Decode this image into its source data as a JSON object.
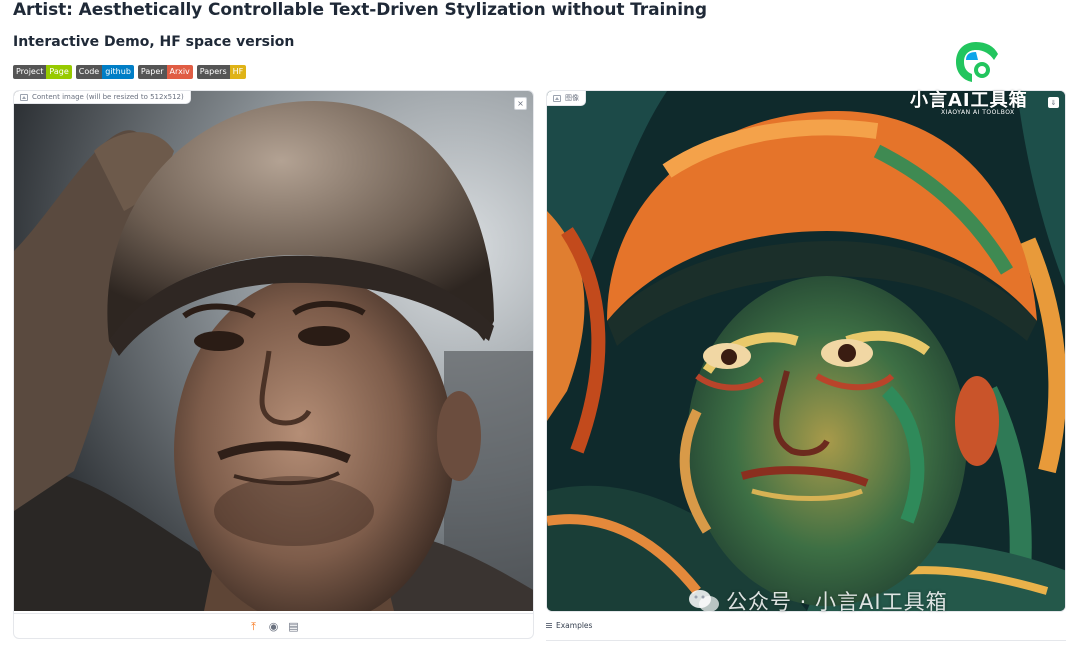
{
  "header": {
    "title": "Artist: Aesthetically Controllable Text-Driven Stylization without Training",
    "subtitle": "Interactive Demo, HF space version"
  },
  "badges": [
    {
      "left": "Project",
      "right": "Page",
      "color": "#97ca00"
    },
    {
      "left": "Code",
      "right": "github",
      "color": "#007ec6"
    },
    {
      "left": "Paper",
      "right": "Arxiv",
      "color": "#e05d44"
    },
    {
      "left": "Papers",
      "right": "HF",
      "color": "#dfb317"
    }
  ],
  "input_panel": {
    "label": "Content image (will be resized to 512x512)",
    "close_label": "×",
    "toolbar_icons": [
      "upload-icon",
      "webcam-icon",
      "clipboard-icon"
    ]
  },
  "output_panel": {
    "label": "图像",
    "download_label": "⇓"
  },
  "examples": {
    "label": "Examples"
  },
  "watermark": {
    "brand": "小言AI工具箱",
    "brand_sub": "XIAOYAN AI TOOLBOX",
    "footer": "公众号 · 小言AI工具箱"
  },
  "colors": {
    "accent": "#f97316",
    "logo_green": "#22c55e",
    "logo_teal": "#0ea5e9"
  }
}
